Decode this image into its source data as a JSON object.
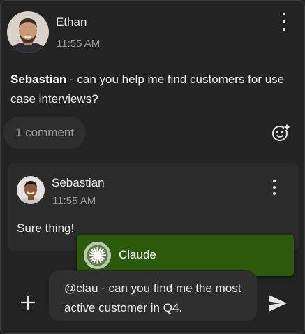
{
  "post": {
    "author": "Ethan",
    "time": "11:55 AM",
    "mention": "Sebastian",
    "text": " - can you help me find customers for use case interviews?",
    "comment_count": "1 comment"
  },
  "reply": {
    "author": "Sebastian",
    "time": "11:55 AM",
    "text": "Sure thing!"
  },
  "mention_popup": {
    "label": "Claude"
  },
  "composer": {
    "value": "@clau - can you find me the most active customer in Q4."
  },
  "icons": {
    "more": "kebab-menu-icon",
    "reaction": "add-emoji-icon",
    "plus": "plus-icon",
    "send": "send-icon",
    "claude": "claude-logo-icon"
  },
  "colors": {
    "background": "#222322",
    "mention_highlight": "#2b5a0d",
    "input_bg": "#2e2f2e"
  }
}
